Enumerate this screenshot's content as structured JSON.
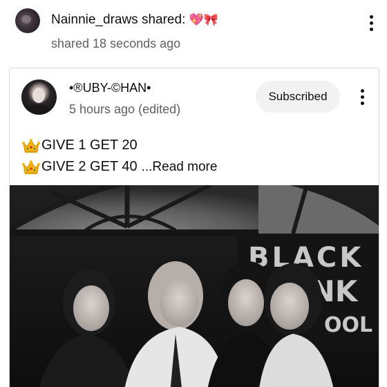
{
  "share": {
    "user": "Nainnie_draws",
    "shared_text": "shared:",
    "emojis": "💖🎀",
    "time": "shared 18 seconds ago"
  },
  "post": {
    "author": "•®UBY-©HAN•",
    "time": "5 hours ago (edited)",
    "subscribe_label": "Subscribed",
    "lines": [
      "GIVE 1 GET 20",
      "GIVE 2 GET 40"
    ],
    "read_more": "...Read more",
    "image_sign_text": [
      "BLACK",
      "INK",
      "OOL"
    ]
  },
  "icons": {
    "crown": "crown-icon",
    "more": "more-vert-icon"
  },
  "colors": {
    "secondary_text": "#606060",
    "button_bg": "#f2f2f2",
    "crown_gold": "#f5b700"
  }
}
